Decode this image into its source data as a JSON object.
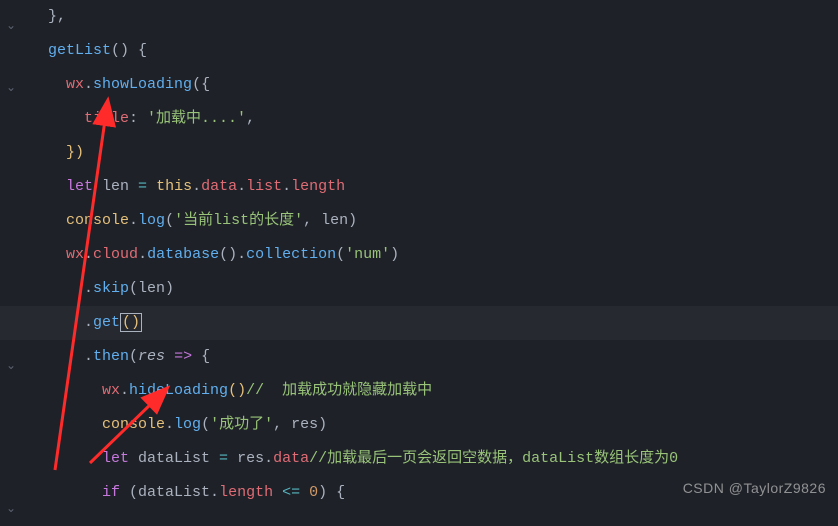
{
  "code": {
    "l1a": "  },",
    "l2a": "  ",
    "l2b": "getList",
    "l2c": "() {",
    "l3a": "    ",
    "l3b": "wx",
    "l3c": ".",
    "l3d": "showLoading",
    "l3e": "({",
    "l4a": "      ",
    "l4b": "title",
    "l4c": ": ",
    "l4d": "'加载中....'",
    "l4e": ",",
    "l5a": "    })",
    "l6a": "    ",
    "l6b": "let",
    "l6c": " len ",
    "l6d": "=",
    "l6e": " ",
    "l6f": "this",
    "l6g": ".",
    "l6h": "data",
    "l6i": ".",
    "l6j": "list",
    "l6k": ".",
    "l6l": "length",
    "l7a": "    ",
    "l7b": "console",
    "l7c": ".",
    "l7d": "log",
    "l7e": "(",
    "l7f": "'当前list的长度'",
    "l7g": ", len)",
    "l8a": "    ",
    "l8b": "wx",
    "l8c": ".",
    "l8d": "cloud",
    "l8e": ".",
    "l8f": "database",
    "l8g": "().",
    "l8h": "collection",
    "l8i": "(",
    "l8j": "'num'",
    "l8k": ")",
    "l9a": "      .",
    "l9b": "skip",
    "l9c": "(len)",
    "l10a": "      .",
    "l10b": "get",
    "l10c": "(",
    "l10d": ")",
    "l11a": "      .",
    "l11b": "then",
    "l11c": "(",
    "l11d": "res",
    "l11e": " ",
    "l11f": "=>",
    "l11g": " {",
    "l12a": "        ",
    "l12b": "wx",
    "l12c": ".",
    "l12d": "hideLoading",
    "l12e": "()",
    "l12f": "//  加载成功就隐藏加载中",
    "l13a": "        ",
    "l13b": "console",
    "l13c": ".",
    "l13d": "log",
    "l13e": "(",
    "l13f": "'成功了'",
    "l13g": ", res)",
    "l14a": "        ",
    "l14b": "let",
    "l14c": " dataList ",
    "l14d": "=",
    "l14e": " res.",
    "l14f": "data",
    "l14g": "//加载最后一页会返回空数据，dataList数组长度为0",
    "l15a": "        ",
    "l15b": "if",
    "l15c": " (dataList.",
    "l15d": "length",
    "l15e": " ",
    "l15f": "<=",
    "l15g": " ",
    "l15h": "0",
    "l15i": ") {",
    "watermark": "CSDN @TaylorZ9826"
  }
}
